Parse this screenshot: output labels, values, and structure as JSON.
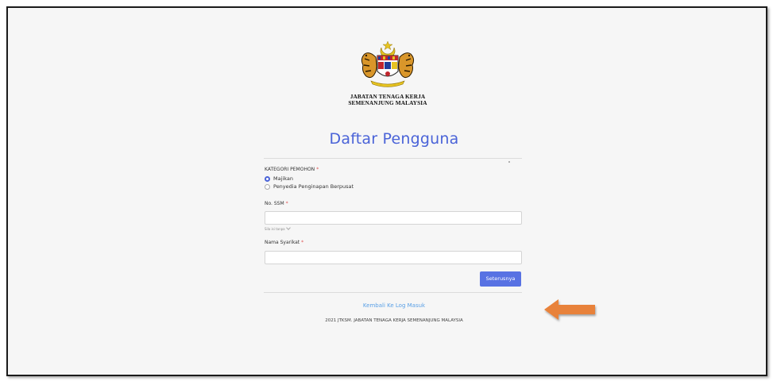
{
  "logo": {
    "line1": "JABATAN TENAGA KERJA",
    "line2": "SEMENANJUNG MALAYSIA"
  },
  "page_title": "Daftar Pengguna",
  "form": {
    "category_label": "KATEGORI PEMOHON",
    "required_mark": "*",
    "options": [
      {
        "label": "Majikan",
        "checked": true
      },
      {
        "label": "Penyedia Penginapan Berpusat",
        "checked": false
      }
    ],
    "ssm_label": "No. SSM",
    "ssm_value": "",
    "ssm_hint": "Sila isi tanpa",
    "company_label": "Nama Syarikat",
    "company_value": "",
    "next_button": "Seterusnya"
  },
  "back_link": "Kembali Ke Log Masuk",
  "footer": "2021 JTKSM. JABATAN TENAGA KERJA SEMENANJUNG MALAYSIA",
  "colors": {
    "accent": "#5872e3",
    "title": "#4a63d8",
    "link": "#5aa0e6",
    "arrow": "#e8823a"
  }
}
